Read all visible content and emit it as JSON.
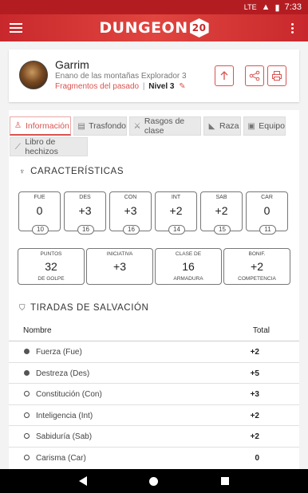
{
  "status": {
    "network": "LTE",
    "time": "7:33"
  },
  "app": {
    "brand": "DUNGEON",
    "brand_badge": "20"
  },
  "character": {
    "name": "Garrim",
    "subtitle": "Enano de las montañas Explorador 3",
    "background_link": "Fragmentos del pasado",
    "separator": "|",
    "level": "Nivel 3"
  },
  "tabs": [
    {
      "icon": "user-icon",
      "label": "Información",
      "active": true
    },
    {
      "icon": "book-icon",
      "label": "Trasfondo",
      "active": false
    },
    {
      "icon": "swords-icon",
      "label": "Rasgos de clase",
      "active": false
    },
    {
      "icon": "boot-icon",
      "label": "Raza",
      "active": false
    },
    {
      "icon": "briefcase-icon",
      "label": "Equipo",
      "active": false
    },
    {
      "icon": "wand-icon",
      "label": "Libro de hechizos",
      "active": false
    }
  ],
  "characteristics": {
    "title": "CARACTERÍSTICAS",
    "abilities": [
      {
        "label": "FUE",
        "mod": "0",
        "score": "10"
      },
      {
        "label": "DES",
        "mod": "+3",
        "score": "16"
      },
      {
        "label": "CON",
        "mod": "+3",
        "score": "16"
      },
      {
        "label": "INT",
        "mod": "+2",
        "score": "14"
      },
      {
        "label": "SAB",
        "mod": "+2",
        "score": "15"
      },
      {
        "label": "CAR",
        "mod": "0",
        "score": "11"
      }
    ],
    "combat": [
      {
        "top": "PUNTOS",
        "value": "32",
        "bottom": "DE GOLPE"
      },
      {
        "top": "INICIATIVA",
        "value": "+3",
        "bottom": ""
      },
      {
        "top": "CLASE DE",
        "value": "16",
        "bottom": "ARMADURA"
      },
      {
        "top": "BONIF.",
        "value": "+2",
        "bottom": "COMPETENCIA"
      }
    ]
  },
  "saves": {
    "title": "TIRADAS DE SALVACIÓN",
    "col_name": "Nombre",
    "col_total": "Total",
    "rows": [
      {
        "name": "Fuerza (Fue)",
        "total": "+2",
        "proficient": true
      },
      {
        "name": "Destreza (Des)",
        "total": "+5",
        "proficient": true
      },
      {
        "name": "Constitución (Con)",
        "total": "+3",
        "proficient": false
      },
      {
        "name": "Inteligencia (Int)",
        "total": "+2",
        "proficient": false
      },
      {
        "name": "Sabiduría (Sab)",
        "total": "+2",
        "proficient": false
      },
      {
        "name": "Carisma (Car)",
        "total": "0",
        "proficient": false
      }
    ]
  },
  "colors": {
    "accent": "#d9534f",
    "appbar": "#c8282c"
  }
}
